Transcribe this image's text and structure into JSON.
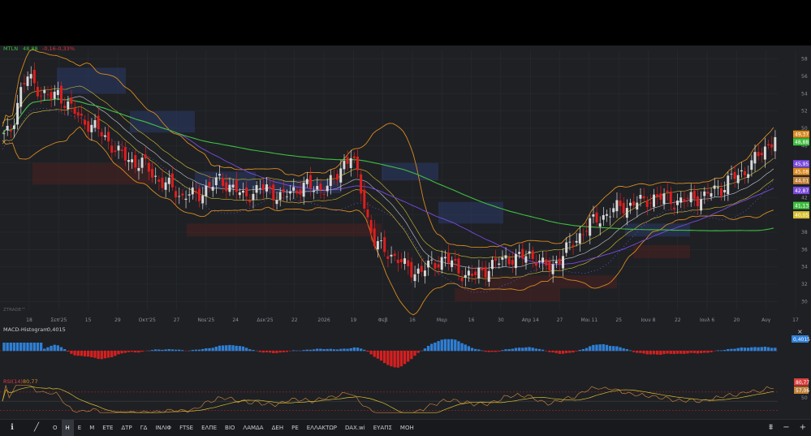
{
  "ticker": {
    "symbol": "MTLN",
    "price": "48,88",
    "change": "-0,16",
    "change_pct": "-0,33%"
  },
  "watermark": "ZTRADE™",
  "colors": {
    "bg": "#1e2024",
    "grid": "#2a2d32",
    "up": "#d9d9d9",
    "down": "#e01e1e",
    "green_ma": "#3fbf3f",
    "orange": "#d98a1f",
    "purple": "#7a4ae0",
    "yellow": "#d8c030",
    "macd_pos": "#2f7fd4",
    "macd_neg": "#d42020",
    "rsi": "#c0803a"
  },
  "chart_data": [
    {
      "type": "candlestick",
      "ylim": [
        29,
        59
      ],
      "yticks": [
        "58",
        "56",
        "54",
        "52",
        "50",
        "48",
        "46",
        "44",
        "42",
        "40",
        "38",
        "36",
        "34",
        "32",
        "30"
      ],
      "x_labels": [
        "18",
        "Σεπ'25",
        "15",
        "29",
        "Οκτ'25",
        "27",
        "Νοε'25",
        "24",
        "Δεκ'25",
        "22",
        "2026",
        "19",
        "Φεβ",
        "16",
        "Μαρ",
        "16",
        "30",
        "Απρ 14",
        "27",
        "Μαι 11",
        "25",
        "Ιουν 8",
        "22",
        "Ιουλ 6",
        "20",
        "Αυγ",
        "17"
      ],
      "close_path": [
        49,
        50,
        54,
        56,
        55,
        54,
        53.5,
        54,
        53,
        52,
        51,
        50.5,
        50,
        49,
        48,
        47,
        46.5,
        46,
        46,
        45,
        44,
        43.5,
        43,
        42,
        42.5,
        42,
        43,
        43.5,
        44,
        43.5,
        43,
        42,
        42.5,
        43,
        43,
        42.5,
        42,
        42.5,
        43,
        43.5,
        43,
        43,
        43.5,
        44,
        46,
        47,
        44,
        40,
        37,
        36,
        35.5,
        35,
        34,
        33.5,
        33.5,
        34,
        34.5,
        35,
        34.5,
        33.5,
        33,
        33,
        33.5,
        34,
        34.5,
        35,
        35,
        35,
        35.5,
        35,
        34,
        34,
        35,
        36,
        37,
        38,
        39,
        39.5,
        40,
        40.5,
        41,
        41,
        41.5,
        41.5,
        42,
        42,
        42,
        41.5,
        41.5,
        42,
        42,
        42,
        43,
        43,
        44,
        44.5,
        45,
        46,
        47,
        48,
        49
      ],
      "price_tags": [
        {
          "label": "49,37",
          "value": 49.37,
          "color": "#d98a1f"
        },
        {
          "label": "48,88",
          "value": 48.88,
          "color": "#3fbf3f"
        },
        {
          "label": "45,95",
          "value": 45.95,
          "color": "#7a4ae0"
        },
        {
          "label": "45,08",
          "value": 45.08,
          "color": "#d98a1f"
        },
        {
          "label": "44,01",
          "value": 44.01,
          "color": "#c0803a"
        },
        {
          "label": "42,87",
          "value": 42.87,
          "color": "#7a4ae0"
        },
        {
          "label": "41,13",
          "value": 41.13,
          "color": "#3fbf3f"
        },
        {
          "label": "40,05",
          "value": 40.05,
          "color": "#d8c030"
        }
      ]
    },
    {
      "type": "bar",
      "title": "MACD-Histogram",
      "last_value": "0,4015"
    },
    {
      "type": "line",
      "title": "RSI(14)",
      "last_value": "80,77",
      "second_value": "57,06",
      "yticks": [
        "70",
        "50"
      ]
    }
  ],
  "toolbar": {
    "items": [
      "Ο",
      "Η",
      "Ε",
      "Μ",
      "ΕΤΕ",
      "ΔΤΡ",
      "ΓΔ",
      "ΙΝΛΙΦ",
      "FTSE",
      "ΕΛΠΕ",
      "ΒΙΟ",
      "ΛΑΜΔΑ",
      "ΔΕΗ",
      "ΡΕ",
      "ΕΛΛΑΚΤΩΡ",
      "DAX.wi",
      "ΕΥΑΠΣ",
      "ΜΟΗ"
    ],
    "active": "Η"
  }
}
